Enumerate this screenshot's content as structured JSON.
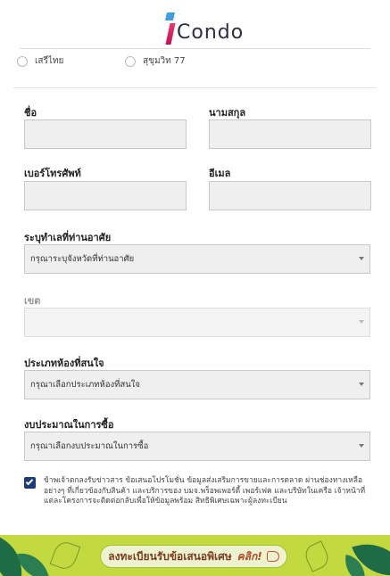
{
  "logo": {
    "text": "Condo"
  },
  "projects": [
    {
      "label": "เสรีไทย"
    },
    {
      "label": "สุขุมวิท 77"
    }
  ],
  "form": {
    "first_name_label": "ชื่อ",
    "last_name_label": "นามสกุล",
    "phone_label": "เบอร์โทรศัพท์",
    "email_label": "อีเมล",
    "province_label": "ระบุทำเลที่ท่านอาศัย",
    "province_placeholder": "กรุณาระบุจังหวัดที่ท่านอาศัย",
    "district_label": "เขต",
    "district_placeholder": "",
    "room_type_label": "ประเภทห้องที่สนใจ",
    "room_type_placeholder": "กรุณาเลือกประเภทห้องที่สนใจ",
    "budget_label": "งบประมาณในการซื้อ",
    "budget_placeholder": "กรุณาเลือกงบประมาณในการซื้อ"
  },
  "consent": {
    "checked": true,
    "text": "ข้าพเจ้าตกลงรับข่าวสาร ข้อเสนอโปรโมชั่น ข้อมูลส่งเสริมการขายและการตลาด ผ่านช่องทางเหลืออย่างๆ ที่เกี่ยวข้องกับสินค้า และบริการของ บมจ.พร็อพเพอร์ตี้ เพอร์เฟค และบริษัทในเครือ เจ้าหน้าที่แต่ละโครงการจะติดต่อกลับเพื่อให้ข้อมูลพร้อม สิทธิพิเศษเฉพาะผู้ลงทะเบียน"
  },
  "banner": {
    "cta_text": "ลงทะเบียนรับข้อเสนอพิเศษ",
    "cta_click": "คลิก!",
    "colors": {
      "background": "#c2d93f",
      "leaf": "#1e6b45"
    }
  }
}
